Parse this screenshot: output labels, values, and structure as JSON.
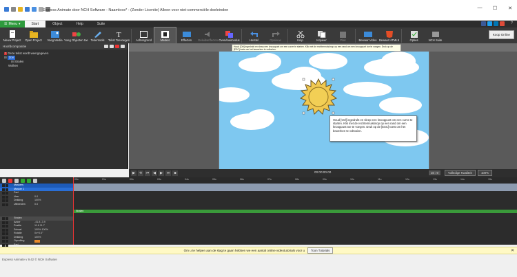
{
  "window": {
    "title": "Express Animate door NCH Software - Naamloos* - (Zonder Licentie) Alleen voor niet-commerciële doeleinden",
    "controls": [
      "—",
      "☐",
      "✕"
    ]
  },
  "menu": {
    "main_label": "Menu",
    "tabs": [
      "Start",
      "Object",
      "Help",
      "Suite"
    ],
    "active_tab": "Start",
    "help_icon": "?"
  },
  "ribbon": {
    "buttons": [
      {
        "label": "Nieuw Project",
        "icon": "new-project-icon"
      },
      {
        "label": "Open Project",
        "icon": "open-project-icon"
      },
      {
        "label": "Voeg Media",
        "icon": "add-media-icon"
      },
      {
        "label": "Voeg Objecten toe",
        "icon": "add-objects-icon"
      },
      {
        "label": "Tekentools",
        "icon": "drawing-tools-icon"
      },
      {
        "label": "Tekst Toevoegen",
        "icon": "text-icon"
      },
      {
        "label": "Achtergrond",
        "icon": "background-icon"
      },
      {
        "label": "Masker",
        "icon": "mask-icon"
      },
      {
        "label": "Effecten",
        "icon": "effects-icon"
      },
      {
        "label": "Geluidseffecten",
        "icon": "sound-effects-icon"
      },
      {
        "label": "Overvloeimodus",
        "icon": "blend-mode-icon"
      },
      {
        "label": "Herstel",
        "icon": "undo-icon"
      },
      {
        "label": "Opnieuw",
        "icon": "redo-icon"
      },
      {
        "label": "Knip",
        "icon": "cut-icon"
      },
      {
        "label": "Kopieer",
        "icon": "copy-icon"
      },
      {
        "label": "Plak",
        "icon": "paste-icon"
      },
      {
        "label": "Bewaar Video",
        "icon": "save-video-icon"
      },
      {
        "label": "Bewaar HTML5",
        "icon": "save-html5-icon"
      },
      {
        "label": "Opties",
        "icon": "options-icon"
      },
      {
        "label": "NCH Suite",
        "icon": "nch-suite-icon"
      }
    ],
    "buy_online": "Koop Online"
  },
  "tooltip_top": "Houd [Ctrl] ingedrukt en sleep een knooppunt om een curve te starten. Klik met de rechtermuisknop op een rand om een knooppunt toe te voegen. Druk op de [ESC] toets om het bewerken te voltooien.",
  "left_panel": {
    "title": "Hoofdcompositie",
    "tree": [
      "Deze tekst wordt weergegeven",
      "Zon",
      "Stralen",
      "Wolken"
    ]
  },
  "stage_tooltip": "Houd [Ctrl] ingedrukt en sleep een knooppunt om een curve te starten. Klik met de rechtermuisknop op een rand om een knooppunt toe te voegen. Druk op de [ESC] toets om het bewerken te voltooien.",
  "transport": {
    "timecode": "00:00:00.00",
    "aspect": "16 : 9",
    "quality": "Volledige Kwaliteit",
    "zoom": "100%"
  },
  "ruler": {
    "ticks": [
      "00s",
      "01s",
      "02s",
      "03s",
      "04s",
      "05s",
      "06s",
      "07s",
      "08s",
      "09s",
      "10s",
      "11s",
      "12s",
      "13s",
      "14s",
      "15s"
    ]
  },
  "timeline": {
    "rows": [
      {
        "name": "Maskers",
        "value": "",
        "style": "blue"
      },
      {
        "name": "Masker 1",
        "value": "",
        "style": "blue2"
      },
      {
        "name": "Pad",
        "value": "",
        "style": ""
      },
      {
        "name": "Veer",
        "value": "0.0",
        "style": ""
      },
      {
        "name": "Dekking",
        "value": "100%",
        "style": ""
      },
      {
        "name": "Uitbreiden",
        "value": "0.0",
        "style": ""
      },
      {
        "name": "",
        "value": "",
        "style": ""
      },
      {
        "name": "Stralen",
        "value": "",
        "style": "hdr"
      },
      {
        "name": "Anker",
        "value": "-41.8   -3.9",
        "style": ""
      },
      {
        "name": "Positie",
        "value": "11.6    11.7",
        "style": ""
      },
      {
        "name": "Schaal",
        "value": "100%   100%",
        "style": ""
      },
      {
        "name": "Rotatie",
        "value": "0x+0.0°",
        "style": ""
      },
      {
        "name": "Dekking",
        "value": "100%",
        "style": ""
      },
      {
        "name": "Opvulling",
        "value": "",
        "style": ""
      },
      {
        "name": "Pad",
        "value": "",
        "style": ""
      }
    ],
    "track_label": "Stralen"
  },
  "notice": {
    "text": "Om u te helpen aan de slag te gaan hebben we een aantal online videotutorials voor u",
    "button": "Toon Tutorials",
    "close": "✕"
  },
  "status": {
    "text": "Express Animate v 9.42 © NCH Software"
  },
  "colors": {
    "sky": "#7ec8f0",
    "sun": "#f0c850",
    "accent_green": "#2e9a3c",
    "selection_blue": "#1e5bb8"
  }
}
